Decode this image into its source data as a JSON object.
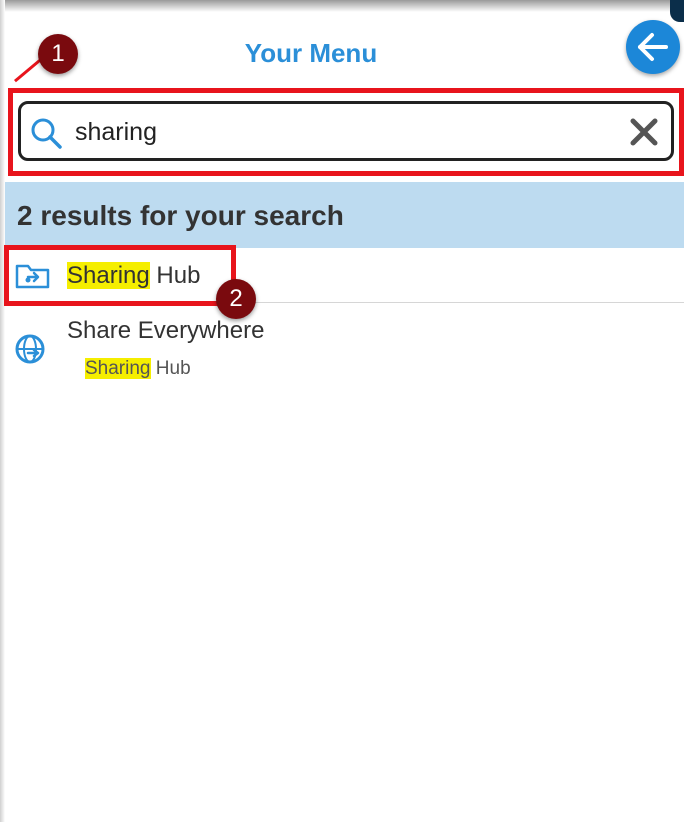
{
  "header": {
    "title": "Your Menu",
    "back_icon": "arrow-left-icon",
    "accent": "#1c87d8"
  },
  "search": {
    "value": "sharing",
    "search_icon": "search-icon",
    "clear_icon": "close-icon"
  },
  "results": {
    "summary": "2 results for your search",
    "items": [
      {
        "icon": "folder-share-icon",
        "highlight": "Sharing",
        "rest": " Hub"
      },
      {
        "icon": "globe-share-icon",
        "title": "Share Everywhere",
        "path_highlight": "Sharing",
        "path_rest": " Hub"
      }
    ]
  },
  "annotations": {
    "badge1": "1",
    "badge2": "2",
    "callout_color": "#e8141c",
    "badge_color": "#7a0a0e",
    "highlight_color": "#f5ee00"
  }
}
